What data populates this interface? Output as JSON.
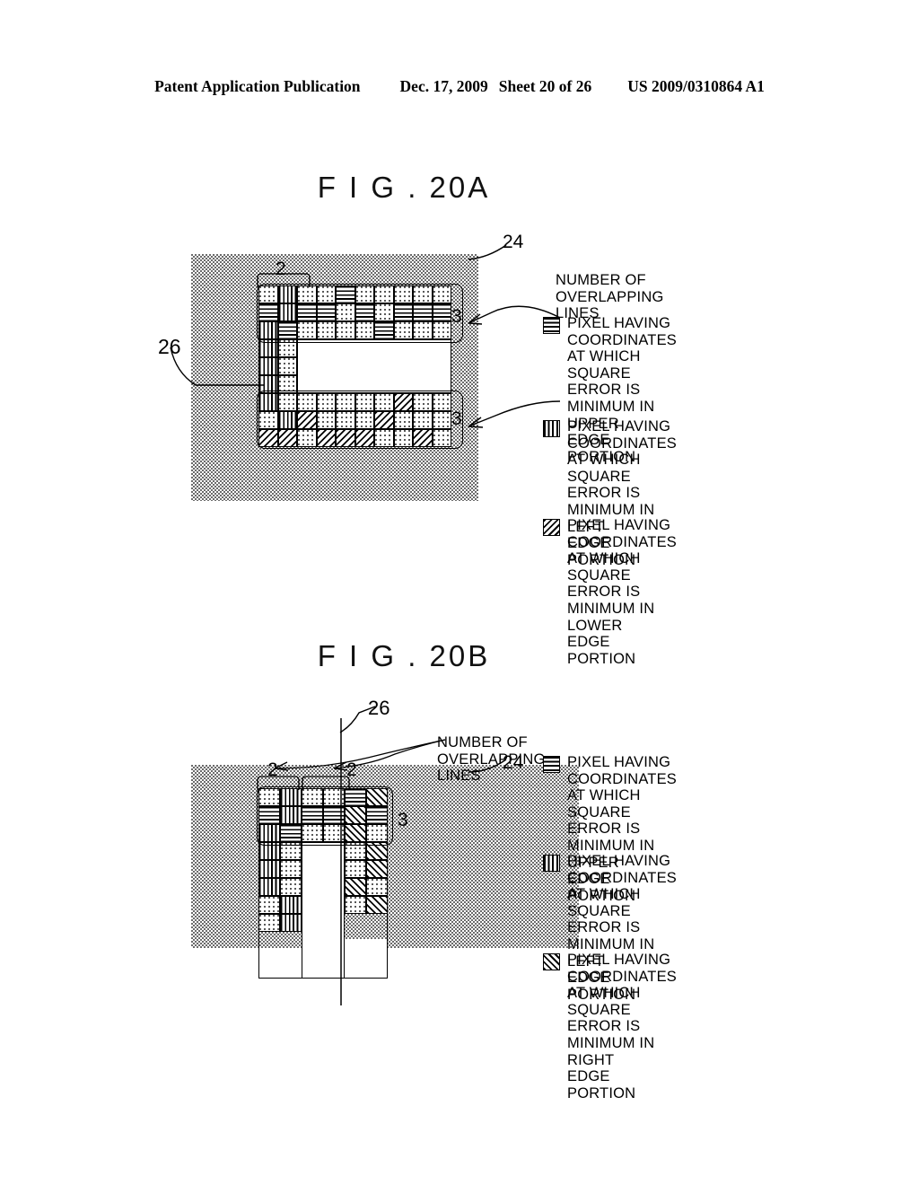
{
  "header": {
    "publication": "Patent Application Publication",
    "date": "Dec. 17, 2009",
    "sheet": "Sheet 20 of 26",
    "patent_number": "US 2009/0310864 A1"
  },
  "figures": [
    {
      "id": "fig20a",
      "title": "F I G . 20A",
      "refs": {
        "background_region": "24",
        "window_region": "26",
        "block_label": "2",
        "block_label_right_top": "3",
        "block_label_right_bottom": "3"
      },
      "legend_title": "NUMBER OF\nOVERLAPPING LINES",
      "legend": [
        {
          "pattern": "horizontal-lines",
          "text": "PIXEL HAVING\nCOORDINATES\nAT WHICH\nSQUARE ERROR IS\nMINIMUM IN UPPER\nEDGE PORTION"
        },
        {
          "pattern": "vertical-lines",
          "text": "PIXEL HAVING\nCOORDINATES\nAT WHICH\nSQUARE ERROR IS\nMINIMUM IN LEFT\nEDGE PORTION"
        },
        {
          "pattern": "back-diagonal-lines",
          "text": "PIXEL HAVING\nCOORDINATES\nAT WHICH\nSQUARE ERROR IS\nMINIMUM IN LOWER\nEDGE PORTION"
        }
      ],
      "grid": {
        "cols": 10,
        "rows": 9,
        "legend_key": {
          "d": "dotted",
          "h": "horizontal-lines",
          "v": "vertical-lines",
          "b": "back-diagonal-lines",
          "f": "forward-diagonal-lines",
          ".": "empty"
        },
        "cells": [
          [
            "d",
            "v",
            "d",
            "d",
            "h",
            "d",
            "d",
            "d",
            "d",
            "d"
          ],
          [
            "h",
            "v",
            "h",
            "h",
            "d",
            "h",
            "d",
            "h",
            "h",
            "h"
          ],
          [
            "v",
            "h",
            "d",
            "d",
            "d",
            "d",
            "h",
            "d",
            "d",
            "d"
          ],
          [
            "v",
            "d",
            ".",
            ".",
            ".",
            ".",
            ".",
            ".",
            ".",
            "."
          ],
          [
            "v",
            "d",
            ".",
            ".",
            ".",
            ".",
            ".",
            ".",
            ".",
            "."
          ],
          [
            "v",
            "d",
            ".",
            ".",
            ".",
            ".",
            ".",
            ".",
            ".",
            "."
          ],
          [
            "v",
            "d",
            "d",
            "d",
            "d",
            "d",
            "d",
            "b",
            "d",
            "d"
          ],
          [
            "d",
            "v",
            "b",
            "d",
            "d",
            "d",
            "b",
            "d",
            "d",
            "d"
          ],
          [
            "b",
            "b",
            "d",
            "b",
            "b",
            "b",
            "d",
            "d",
            "b",
            "d"
          ]
        ]
      }
    },
    {
      "id": "fig20b",
      "title": "F I G . 20B",
      "refs": {
        "background_region": "24",
        "window_region": "26",
        "block_label_left": "2",
        "block_label_right": "2",
        "block_label_bracket": "3"
      },
      "legend_title": "NUMBER OF\nOVERLAPPING LINES",
      "legend": [
        {
          "pattern": "horizontal-lines",
          "text": "PIXEL HAVING\nCOORDINATES\nAT WHICH\nSQUARE ERROR IS\nMINIMUM IN UPPER\nEDGE PORTION"
        },
        {
          "pattern": "vertical-lines",
          "text": "PIXEL HAVING\nCOORDINATES\nAT WHICH\nSQUARE ERROR IS\nMINIMUM IN LEFT\nEDGE PORTION"
        },
        {
          "pattern": "forward-diagonal-lines",
          "text": "PIXEL HAVING\nCOORDINATES\nAT WHICH\nSQUARE ERROR IS\nMINIMUM IN RIGHT\nEDGE PORTION"
        }
      ],
      "grid": {
        "cols": 6,
        "rows": 9,
        "legend_key": {
          "d": "dotted",
          "h": "horizontal-lines",
          "v": "vertical-lines",
          "f": "forward-diagonal-lines",
          ".": "empty"
        },
        "cells": [
          [
            "d",
            "v",
            "d",
            "d",
            "h",
            "f"
          ],
          [
            "h",
            "v",
            "h",
            "h",
            "f",
            "h"
          ],
          [
            "v",
            "h",
            "d",
            "d",
            "f",
            "d"
          ],
          [
            "v",
            "d",
            ".",
            ".",
            "d",
            "f"
          ],
          [
            "v",
            "d",
            ".",
            ".",
            "d",
            "f"
          ],
          [
            "v",
            "d",
            ".",
            ".",
            "f",
            "d"
          ],
          [
            "d",
            "v",
            ".",
            ".",
            "d",
            "f"
          ],
          [
            "d",
            "v",
            ".",
            ".",
            ".",
            "."
          ],
          [
            ".",
            ".",
            ".",
            ".",
            ".",
            "."
          ]
        ]
      }
    }
  ]
}
